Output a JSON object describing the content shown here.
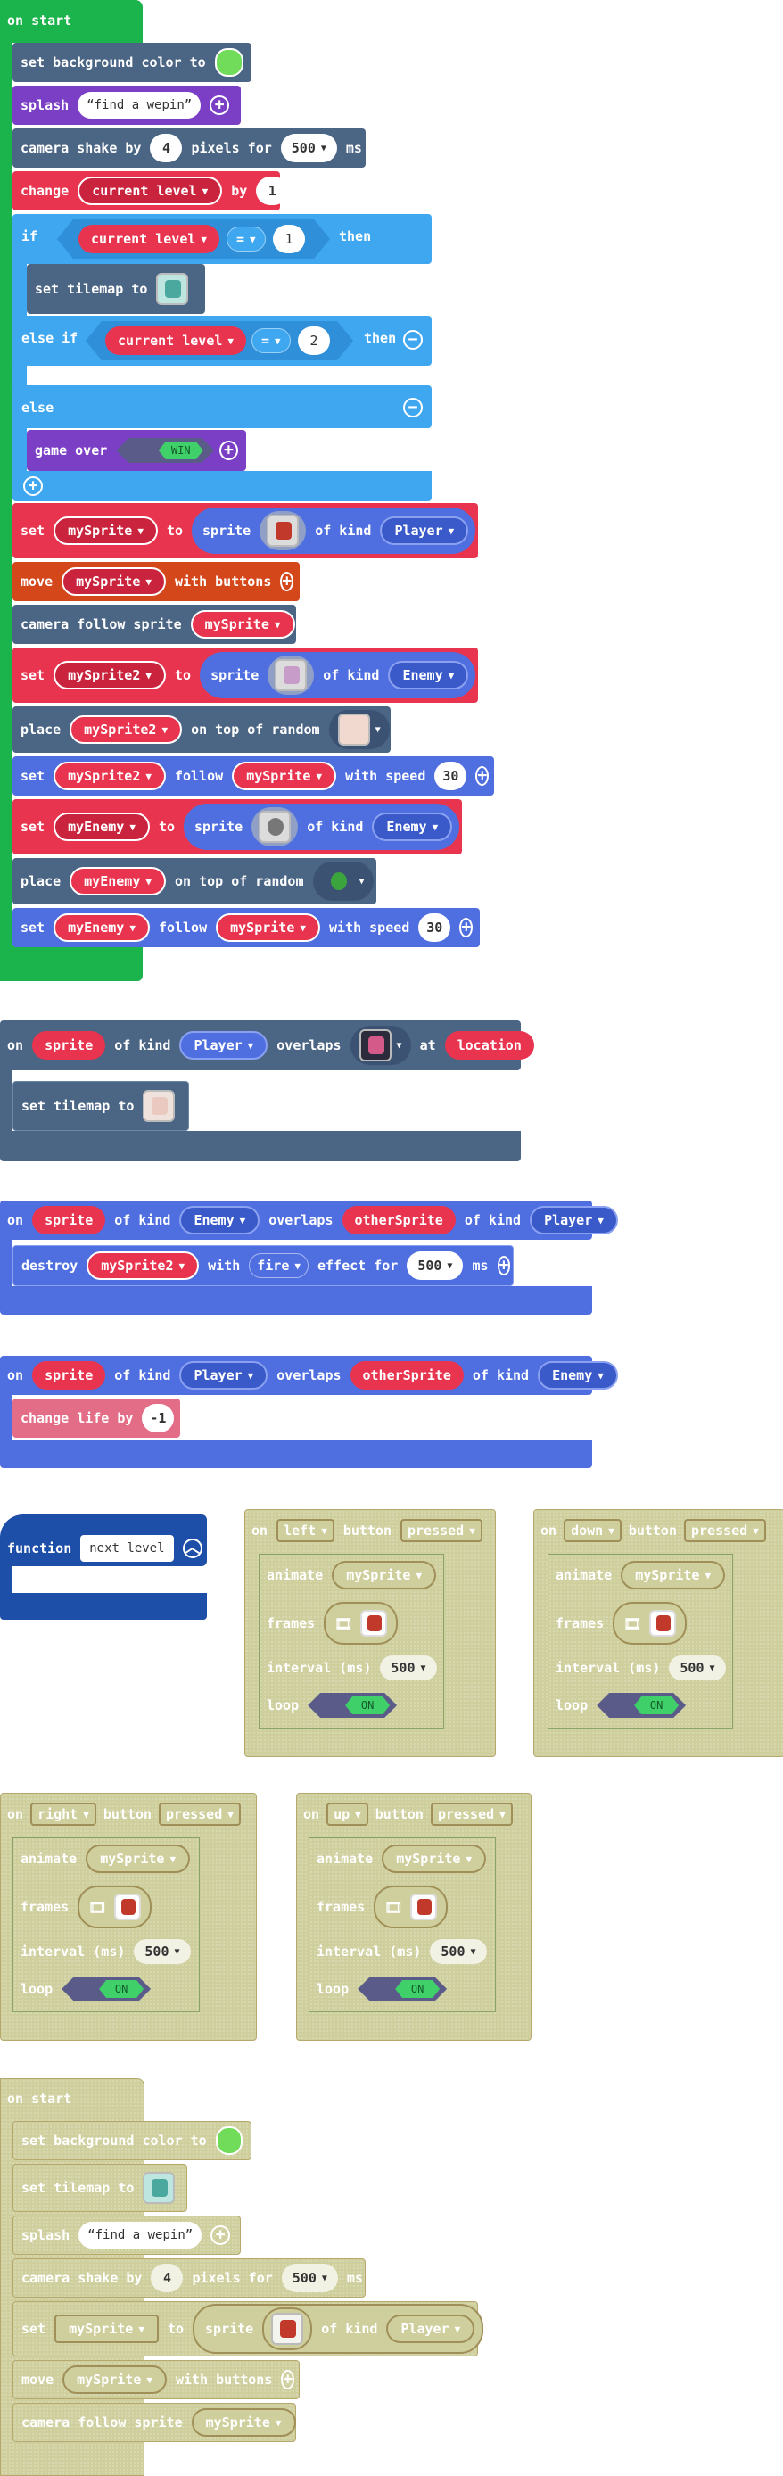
{
  "colors": {
    "events": "#1bb34c",
    "scene": "#4b6584",
    "sprites": "#4f6fe0",
    "logic": "#3fa7f0",
    "vars": "#e8344e",
    "game": "#7b3fc6",
    "controller": "#d4471a",
    "functions": "#1d4ea8",
    "disabled": "#cfcf9d"
  },
  "labels": {
    "on_start": "on start",
    "set_bg": "set background color to",
    "splash": "splash",
    "splash_text": "find a wepin",
    "camera_shake": "camera shake by",
    "pixels_for": "pixels for",
    "ms": "ms",
    "shake_amount": "4",
    "shake_ms": "500",
    "change": "change",
    "current_level": "current level",
    "by": "by",
    "change_by": "1",
    "if": "if",
    "eq": "=",
    "then": "then",
    "if_value": "1",
    "set_tilemap": "set tilemap to",
    "else_if": "else if",
    "elseif_value": "2",
    "else": "else",
    "game_over": "game over",
    "win": "WIN",
    "set": "set",
    "mySprite": "mySprite",
    "to": "to",
    "sprite": "sprite",
    "of_kind": "of kind",
    "player": "Player",
    "move": "move",
    "with_buttons": "with buttons",
    "camera_follow": "camera follow sprite",
    "mySprite2": "mySprite2",
    "enemy": "Enemy",
    "place": "place",
    "on_top_random": "on top of random",
    "follow": "follow",
    "with_speed": "with speed",
    "speed": "30",
    "myEnemy": "myEnemy",
    "on": "on",
    "sprite_var": "sprite",
    "overlaps": "overlaps",
    "at": "at",
    "location": "location",
    "otherSprite": "otherSprite",
    "destroy": "destroy",
    "with": "with",
    "fire": "fire",
    "effect_for": "effect for",
    "destroy_ms": "500",
    "change_life": "change life by",
    "life_delta": "-1",
    "function": "function",
    "fn_name": "next level",
    "left": "left",
    "down": "down",
    "right": "right",
    "up": "up",
    "button": "button",
    "pressed": "pressed",
    "animate": "animate",
    "frames": "frames",
    "interval": "interval (ms)",
    "interval_val": "500",
    "loop": "loop",
    "on_toggle": "ON"
  }
}
